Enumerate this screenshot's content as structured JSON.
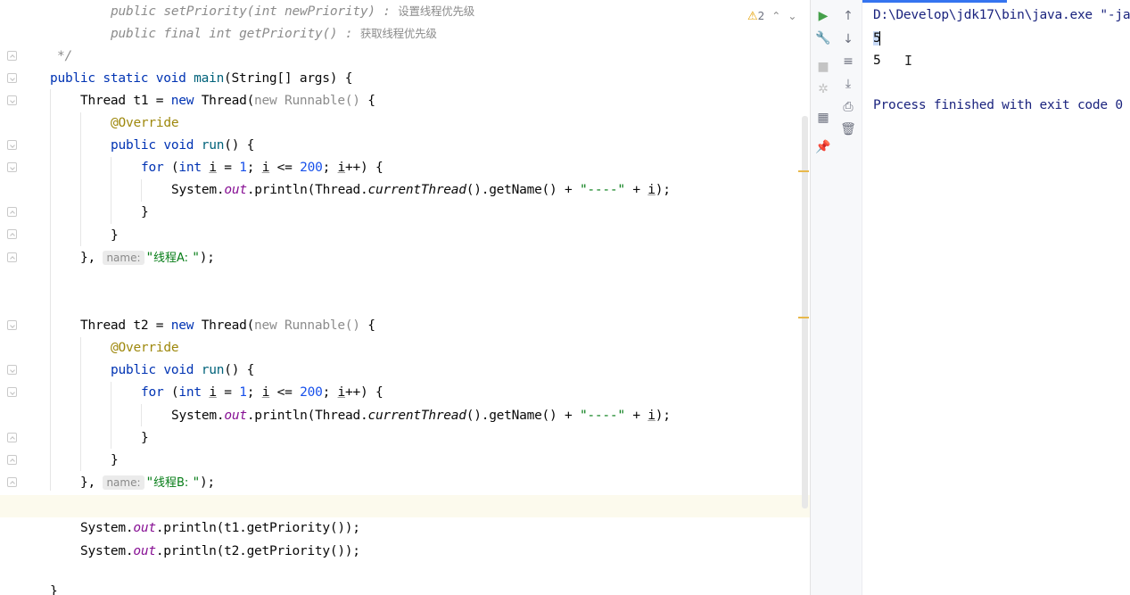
{
  "editor": {
    "inspection": {
      "warning_count": "2",
      "warn_icon": "warning-icon",
      "up": "⌃",
      "down": "⌄"
    },
    "lines": {
      "l1_a": "public ",
      "l1_b": "setPriority",
      "l1_c": "(int newPriority) : ",
      "l1_d": "设置线程优先级",
      "l2_a": "public final int ",
      "l2_b": "getPriority",
      "l2_c": "() : ",
      "l2_d": "获取线程优先级",
      "l3": "*/",
      "l4_kw": "public static void ",
      "l4_fn": "main",
      "l4_rest": "(String[] args) {",
      "l5_a": "Thread t1 = ",
      "l5_new": "new ",
      "l5_thr": "Thread(",
      "l5_gray": "new Runnable() ",
      "l5_end": "{",
      "l6": "@Override",
      "l7_kw": "public void ",
      "l7_fn": "run",
      "l7_end": "() {",
      "l8_for": "for ",
      "l8_p1": "(",
      "l8_int": "int ",
      "l8_i": "i",
      "l8_eq": " = ",
      "l8_one": "1",
      "l8_semi": "; ",
      "l8_i2": "i",
      "l8_le": " <= ",
      "l8_200": "200",
      "l8_semi2": "; ",
      "l8_i3": "i",
      "l8_end": "++) {",
      "l9_a": "System.",
      "l9_out": "out",
      "l9_b": ".println(Thread.",
      "l9_ct": "currentThread",
      "l9_c": "().getName() + ",
      "l9_str": "\"----\"",
      "l9_d": " + ",
      "l9_i": "i",
      "l9_e": ");",
      "l10": "}",
      "l11": "}",
      "l12_a": "}, ",
      "l12_hint": "name:",
      "l12_q1": "\"",
      "l12_cn": "线程A: ",
      "l12_q2": "\"",
      "l12_end": ");",
      "l13_a": "Thread t2 = ",
      "l13_new": "new ",
      "l13_thr": "Thread(",
      "l13_gray": "new Runnable() ",
      "l13_end": "{",
      "l14": "@Override",
      "l15_kw": "public void ",
      "l15_fn": "run",
      "l15_end": "() {",
      "l16_for": "for ",
      "l16_p1": "(",
      "l16_int": "int ",
      "l16_i": "i",
      "l16_eq": " = ",
      "l16_one": "1",
      "l16_semi": "; ",
      "l16_i2": "i",
      "l16_le": " <= ",
      "l16_200": "200",
      "l16_semi2": "; ",
      "l16_i3": "i",
      "l16_end": "++) {",
      "l17_a": "System.",
      "l17_out": "out",
      "l17_b": ".println(Thread.",
      "l17_ct": "currentThread",
      "l17_c": "().getName() + ",
      "l17_str": "\"----\"",
      "l17_d": " + ",
      "l17_i": "i",
      "l17_e": ");",
      "l18": "}",
      "l19": "}",
      "l20_a": "}, ",
      "l20_hint": "name:",
      "l20_q1": "\"",
      "l20_cn": "线程B: ",
      "l20_q2": "\"",
      "l20_end": ");",
      "l21_a": "System.",
      "l21_out": "out",
      "l21_b": ".println(t1.getPriority());",
      "l22_a": "System.",
      "l22_out": "out",
      "l22_b": ".println(t2.getPriority());",
      "l23": "}"
    }
  },
  "run": {
    "toolbar_left": [
      "run-icon",
      "wrench-icon",
      "stop-icon",
      "debug-icon",
      "layout-icon",
      "pin-icon"
    ],
    "toolbar_right": [
      "arrow-up-icon",
      "arrow-down-icon",
      "soft-wrap-icon",
      "scroll-to-end-icon",
      "print-icon",
      "trash-icon"
    ],
    "console": {
      "command": "D:\\Develop\\jdk17\\bin\\java.exe \"-ja",
      "out1": "5",
      "out2": "5",
      "exit": "Process finished with exit code 0"
    }
  },
  "colors": {
    "keyword": "#0033b3",
    "string": "#067d17",
    "number": "#1750eb",
    "annotation": "#9e880d",
    "static_field": "#871094",
    "accent": "#3574f0"
  }
}
